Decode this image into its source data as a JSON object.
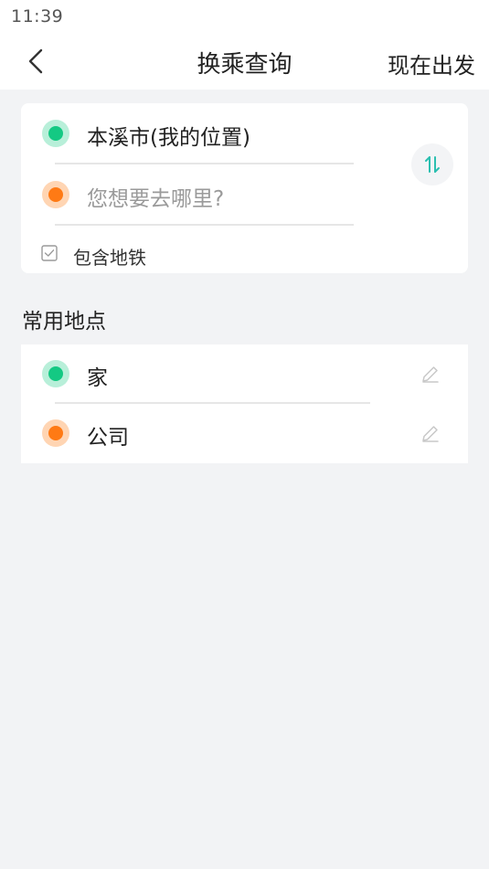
{
  "status_bar": {
    "time": "11:39"
  },
  "nav": {
    "back_icon": "chevron-left-icon",
    "title": "换乘查询",
    "depart_now": "现在出发"
  },
  "route": {
    "origin": "本溪市(我的位置)",
    "destination_placeholder": "您想要去哪里?",
    "swap_icon": "swap-vertical-icon",
    "include_subway_label": "包含地铁",
    "include_subway_checked": false
  },
  "favorites": {
    "title": "常用地点",
    "items": [
      {
        "label": "家",
        "dot_color": "#14c983",
        "edit_icon": "pencil-icon"
      },
      {
        "label": "公司",
        "dot_color": "#ff7a14",
        "edit_icon": "pencil-icon"
      }
    ]
  },
  "colors": {
    "accent_teal": "#2bbfb0",
    "origin_green": "#14c983",
    "destination_orange": "#ff7a14",
    "background": "#f2f3f5"
  }
}
